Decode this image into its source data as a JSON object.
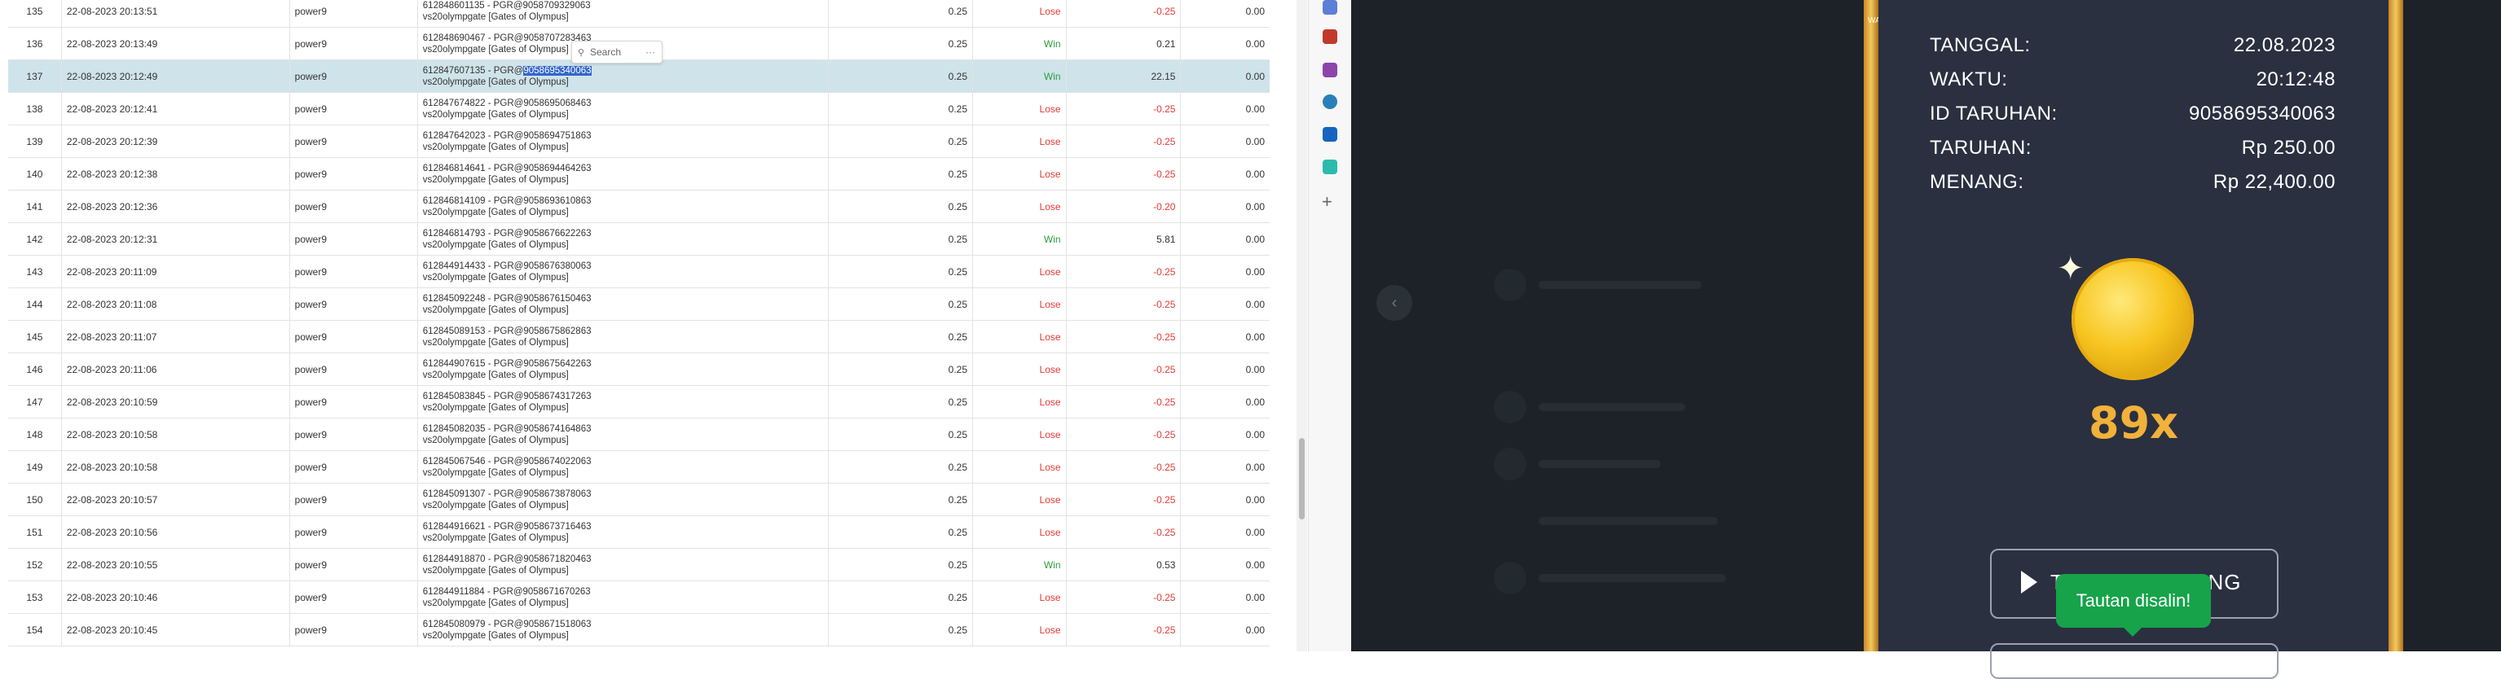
{
  "table": {
    "rows": [
      {
        "no": "135",
        "time": "22-08-2023 20:13:51",
        "user": "power9",
        "det1": "612848601135 - PGR@9058709329063",
        "det2": "vs20olympgate [Gates of Olympus]",
        "stake": "0.25",
        "result": "Lose",
        "win": "-0.25",
        "jp": "0.00"
      },
      {
        "no": "136",
        "time": "22-08-2023 20:13:49",
        "user": "power9",
        "det1": "612848690467 - PGR@9058707283463",
        "det2": "vs20olympgate [Gates of Olympus]",
        "stake": "0.25",
        "result": "Win",
        "win": "0.21",
        "jp": "0.00"
      },
      {
        "no": "137",
        "time": "22-08-2023 20:12:49",
        "user": "power9",
        "det1": "612847607135 - PGR@",
        "det1_hl": "9058695340063",
        "det2": "vs20olympgate [Gates of Olympus]",
        "stake": "0.25",
        "result": "Win",
        "win": "22.15",
        "jp": "0.00",
        "selected": true
      },
      {
        "no": "138",
        "time": "22-08-2023 20:12:41",
        "user": "power9",
        "det1": "612847674822 - PGR@9058695068463",
        "det2": "vs20olympgate [Gates of Olympus]",
        "stake": "0.25",
        "result": "Lose",
        "win": "-0.25",
        "jp": "0.00"
      },
      {
        "no": "139",
        "time": "22-08-2023 20:12:39",
        "user": "power9",
        "det1": "612847642023 - PGR@9058694751863",
        "det2": "vs20olympgate [Gates of Olympus]",
        "stake": "0.25",
        "result": "Lose",
        "win": "-0.25",
        "jp": "0.00"
      },
      {
        "no": "140",
        "time": "22-08-2023 20:12:38",
        "user": "power9",
        "det1": "612846814641 - PGR@9058694464263",
        "det2": "vs20olympgate [Gates of Olympus]",
        "stake": "0.25",
        "result": "Lose",
        "win": "-0.25",
        "jp": "0.00"
      },
      {
        "no": "141",
        "time": "22-08-2023 20:12:36",
        "user": "power9",
        "det1": "612846814109 - PGR@9058693610863",
        "det2": "vs20olympgate [Gates of Olympus]",
        "stake": "0.25",
        "result": "Lose",
        "win": "-0.20",
        "jp": "0.00"
      },
      {
        "no": "142",
        "time": "22-08-2023 20:12:31",
        "user": "power9",
        "det1": "612846814793 - PGR@9058676622263",
        "det2": "vs20olympgate [Gates of Olympus]",
        "stake": "0.25",
        "result": "Win",
        "win": "5.81",
        "jp": "0.00"
      },
      {
        "no": "143",
        "time": "22-08-2023 20:11:09",
        "user": "power9",
        "det1": "612844914433 - PGR@9058676380063",
        "det2": "vs20olympgate [Gates of Olympus]",
        "stake": "0.25",
        "result": "Lose",
        "win": "-0.25",
        "jp": "0.00"
      },
      {
        "no": "144",
        "time": "22-08-2023 20:11:08",
        "user": "power9",
        "det1": "612845092248 - PGR@9058676150463",
        "det2": "vs20olympgate [Gates of Olympus]",
        "stake": "0.25",
        "result": "Lose",
        "win": "-0.25",
        "jp": "0.00"
      },
      {
        "no": "145",
        "time": "22-08-2023 20:11:07",
        "user": "power9",
        "det1": "612845089153 - PGR@9058675862863",
        "det2": "vs20olympgate [Gates of Olympus]",
        "stake": "0.25",
        "result": "Lose",
        "win": "-0.25",
        "jp": "0.00"
      },
      {
        "no": "146",
        "time": "22-08-2023 20:11:06",
        "user": "power9",
        "det1": "612844907615 - PGR@9058675642263",
        "det2": "vs20olympgate [Gates of Olympus]",
        "stake": "0.25",
        "result": "Lose",
        "win": "-0.25",
        "jp": "0.00"
      },
      {
        "no": "147",
        "time": "22-08-2023 20:10:59",
        "user": "power9",
        "det1": "612845083845 - PGR@9058674317263",
        "det2": "vs20olympgate [Gates of Olympus]",
        "stake": "0.25",
        "result": "Lose",
        "win": "-0.25",
        "jp": "0.00"
      },
      {
        "no": "148",
        "time": "22-08-2023 20:10:58",
        "user": "power9",
        "det1": "612845082035 - PGR@9058674164863",
        "det2": "vs20olympgate [Gates of Olympus]",
        "stake": "0.25",
        "result": "Lose",
        "win": "-0.25",
        "jp": "0.00"
      },
      {
        "no": "149",
        "time": "22-08-2023 20:10:58",
        "user": "power9",
        "det1": "612845067546 - PGR@9058674022063",
        "det2": "vs20olympgate [Gates of Olympus]",
        "stake": "0.25",
        "result": "Lose",
        "win": "-0.25",
        "jp": "0.00"
      },
      {
        "no": "150",
        "time": "22-08-2023 20:10:57",
        "user": "power9",
        "det1": "612845091307 - PGR@9058673878063",
        "det2": "vs20olympgate [Gates of Olympus]",
        "stake": "0.25",
        "result": "Lose",
        "win": "-0.25",
        "jp": "0.00"
      },
      {
        "no": "151",
        "time": "22-08-2023 20:10:56",
        "user": "power9",
        "det1": "612844916621 - PGR@9058673716463",
        "det2": "vs20olympgate [Gates of Olympus]",
        "stake": "0.25",
        "result": "Lose",
        "win": "-0.25",
        "jp": "0.00"
      },
      {
        "no": "152",
        "time": "22-08-2023 20:10:55",
        "user": "power9",
        "det1": "612844918870 - PGR@9058671820463",
        "det2": "vs20olympgate [Gates of Olympus]",
        "stake": "0.25",
        "result": "Win",
        "win": "0.53",
        "jp": "0.00"
      },
      {
        "no": "153",
        "time": "22-08-2023 20:10:46",
        "user": "power9",
        "det1": "612844911884 - PGR@9058671670263",
        "det2": "vs20olympgate [Gates of Olympus]",
        "stake": "0.25",
        "result": "Lose",
        "win": "-0.25",
        "jp": "0.00"
      },
      {
        "no": "154",
        "time": "22-08-2023 20:10:45",
        "user": "power9",
        "det1": "612845080979 - PGR@9058671518063",
        "det2": "vs20olympgate [Gates of Olympus]",
        "stake": "0.25",
        "result": "Lose",
        "win": "-0.25",
        "jp": "0.00"
      }
    ]
  },
  "search_popup": {
    "label": "Search",
    "more": "···",
    "icon": "search-icon"
  },
  "receipt": {
    "rows": [
      {
        "label": "TANGGAL:",
        "value": "22.08.2023"
      },
      {
        "label": "WAKTU:",
        "value": "20:12:48"
      },
      {
        "label": "ID TARUHAN:",
        "value": "9058695340063"
      },
      {
        "label": "TARUHAN:",
        "value": "Rp 250.00"
      },
      {
        "label": "MENANG:",
        "value": "Rp 22,400.00"
      }
    ],
    "multiplier": "89x",
    "share_button_label": "TAUTAN MENANG",
    "toast": "Tautan disalin!",
    "corner_tag": "WA"
  },
  "colors": {
    "lose": "#e53935",
    "win": "#2e9c3c",
    "selected_row": "#cfe3ea",
    "toast": "#16a34a"
  }
}
